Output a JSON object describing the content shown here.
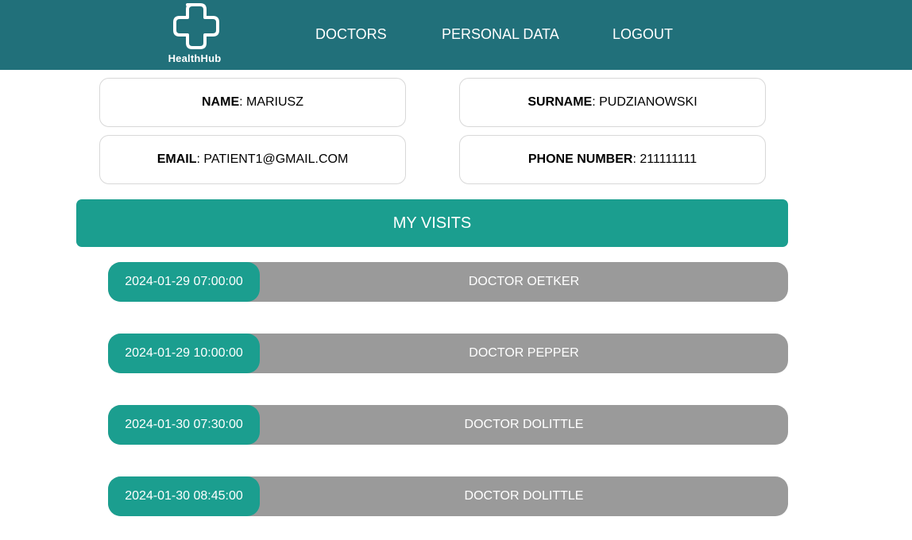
{
  "header": {
    "logo_text": "HealthHub",
    "logo_icon": "cross-icon",
    "nav": {
      "doctors": "DOCTORS",
      "personal_data": "PERSONAL DATA",
      "logout": "LOGOUT"
    }
  },
  "profile": {
    "name": {
      "label": "NAME",
      "value": "MARIUSZ"
    },
    "surname": {
      "label": "SURNAME",
      "value": "PUDZIANOWSKI"
    },
    "email": {
      "label": "EMAIL",
      "value": "PATIENT1@GMAIL.COM"
    },
    "phone": {
      "label": "PHONE NUMBER",
      "value": "211111111"
    }
  },
  "visits": {
    "title": "MY VISITS",
    "items": [
      {
        "date": "2024-01-29 07:00:00",
        "doctor": "DOCTOR OETKER"
      },
      {
        "date": "2024-01-29 10:00:00",
        "doctor": "DOCTOR PEPPER"
      },
      {
        "date": "2024-01-30 07:30:00",
        "doctor": "DOCTOR DOLITTLE"
      },
      {
        "date": "2024-01-30 08:45:00",
        "doctor": "DOCTOR DOLITTLE"
      }
    ]
  },
  "colors": {
    "header_bg": "#21707a",
    "accent": "#1b9e8f",
    "visit_bg": "#9a9a9a"
  }
}
